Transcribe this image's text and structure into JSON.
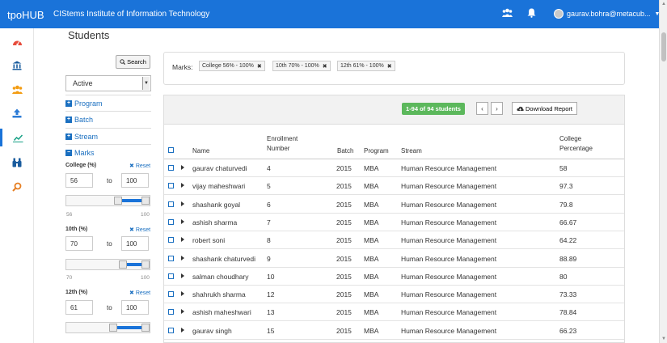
{
  "header": {
    "brand": "tpoHUB",
    "org": "CIStems Institute of Information Technology",
    "user_email": "gaurav.bohra@metacub..."
  },
  "rail": {
    "icons": [
      "dashboard-icon",
      "institution-icon",
      "users-icon",
      "upload-icon",
      "chart-icon",
      "binoculars-icon",
      "search-icon"
    ],
    "active": "chart-icon"
  },
  "page": {
    "title": "Students"
  },
  "filters": {
    "search_label": "Search",
    "status_value": "Active",
    "facets": [
      "Program",
      "Batch",
      "Stream",
      "Marks"
    ],
    "reset_label": "Reset",
    "to_label": "to",
    "ranges": [
      {
        "label": "College (%)",
        "from": "56",
        "to": "100",
        "min": "56",
        "max": "100",
        "fill_start": 0.62,
        "fill_end": 0.97
      },
      {
        "label": "10th (%)",
        "from": "70",
        "to": "100",
        "min": "70",
        "max": "100",
        "fill_start": 0.68,
        "fill_end": 0.97
      },
      {
        "label": "12th (%)",
        "from": "61",
        "to": "100",
        "min": "61",
        "max": "100",
        "fill_start": 0.56,
        "fill_end": 0.97
      }
    ]
  },
  "marks": {
    "label": "Marks:",
    "chips": [
      "College 56% - 100%",
      "10th 70% - 100%",
      "12th 61% - 100%"
    ]
  },
  "results": {
    "count": "1-94 of 94 students",
    "download_label": "Download Report",
    "columns": {
      "name": "Name",
      "enrollment": "Enrollment Number",
      "batch": "Batch",
      "program": "Program",
      "stream": "Stream",
      "college": "College Percentage"
    },
    "rows": [
      {
        "name": "gaurav chaturvedi",
        "enrollment": "4",
        "batch": "2015",
        "program": "MBA",
        "stream": "Human Resource Management",
        "college": "58"
      },
      {
        "name": "vijay maheshwari",
        "enrollment": "5",
        "batch": "2015",
        "program": "MBA",
        "stream": "Human Resource Management",
        "college": "97.3"
      },
      {
        "name": "shashank goyal",
        "enrollment": "6",
        "batch": "2015",
        "program": "MBA",
        "stream": "Human Resource Management",
        "college": "79.8"
      },
      {
        "name": "ashish sharma",
        "enrollment": "7",
        "batch": "2015",
        "program": "MBA",
        "stream": "Human Resource Management",
        "college": "66.67"
      },
      {
        "name": "robert soni",
        "enrollment": "8",
        "batch": "2015",
        "program": "MBA",
        "stream": "Human Resource Management",
        "college": "64.22"
      },
      {
        "name": "shashank chaturvedi",
        "enrollment": "9",
        "batch": "2015",
        "program": "MBA",
        "stream": "Human Resource Management",
        "college": "88.89"
      },
      {
        "name": "salman choudhary",
        "enrollment": "10",
        "batch": "2015",
        "program": "MBA",
        "stream": "Human Resource Management",
        "college": "80"
      },
      {
        "name": "shahrukh sharma",
        "enrollment": "12",
        "batch": "2015",
        "program": "MBA",
        "stream": "Human Resource Management",
        "college": "73.33"
      },
      {
        "name": "ashish maheshwari",
        "enrollment": "13",
        "batch": "2015",
        "program": "MBA",
        "stream": "Human Resource Management",
        "college": "78.84"
      },
      {
        "name": "gaurav singh",
        "enrollment": "15",
        "batch": "2015",
        "program": "MBA",
        "stream": "Human Resource Management",
        "college": "66.23"
      }
    ]
  },
  "colors": {
    "primary": "#1a73d9",
    "success": "#5cb85c",
    "link": "#1a6fc0"
  }
}
